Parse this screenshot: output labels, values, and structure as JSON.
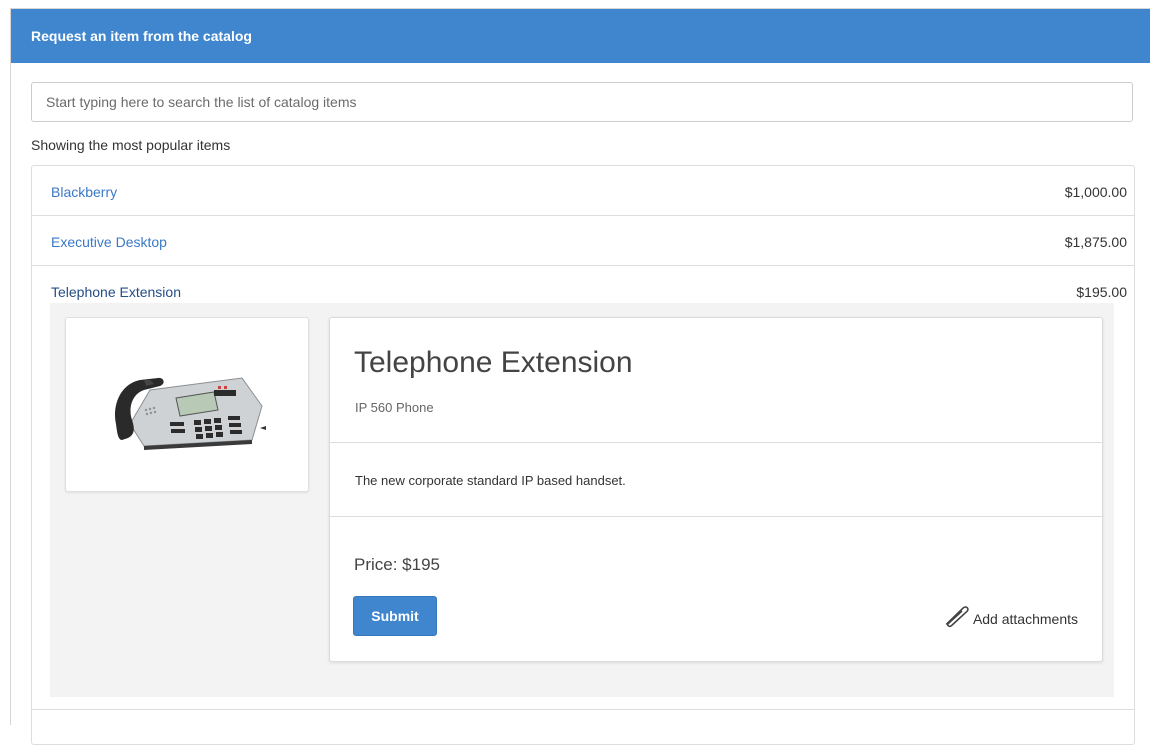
{
  "header": {
    "title": "Request an item from the catalog"
  },
  "search": {
    "placeholder": "Start typing here to search the list of catalog items"
  },
  "showing_label": "Showing the most popular items",
  "items": [
    {
      "name": "Blackberry",
      "price": "$1,000.00"
    },
    {
      "name": "Executive Desktop",
      "price": "$1,875.00"
    },
    {
      "name": "Telephone Extension",
      "price": "$195.00"
    }
  ],
  "detail": {
    "image_icon": "desk-phone-image",
    "title": "Telephone Extension",
    "subtitle": "IP 560 Phone",
    "description": "The new corporate standard IP based handset.",
    "price": "Price: $195",
    "submit_label": "Submit",
    "attach_icon": "paperclip-icon",
    "attach_label": "Add attachments"
  },
  "colors": {
    "header_bg": "#3f86cf",
    "link": "#3a79c7",
    "button": "#3f86cf"
  }
}
